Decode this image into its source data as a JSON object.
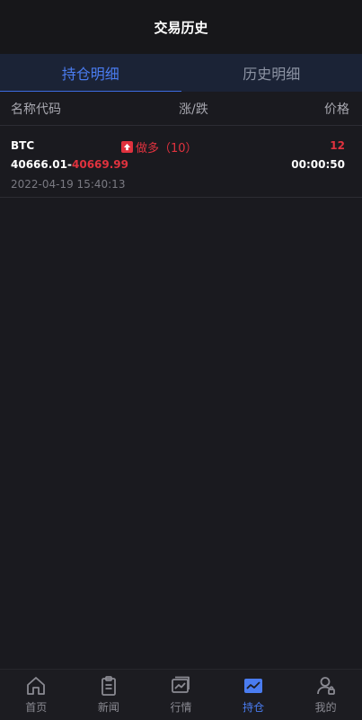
{
  "header": {
    "title": "交易历史"
  },
  "tabs": [
    {
      "label": "持仓明细",
      "active": true
    },
    {
      "label": "历史明细",
      "active": false
    }
  ],
  "columns": {
    "name": "名称代码",
    "change": "涨/跌",
    "price": "价格"
  },
  "positions": [
    {
      "symbol": "BTC",
      "open_price": "40666.01",
      "separator": "-",
      "current_price": "40669.99",
      "datetime": "2022-04-19 15:40:13",
      "direction": "做多（10）",
      "amount": "12",
      "countdown": "00:00:50"
    }
  ],
  "nav": [
    {
      "label": "首页",
      "icon": "home-icon",
      "active": false
    },
    {
      "label": "新闻",
      "icon": "news-icon",
      "active": false
    },
    {
      "label": "行情",
      "icon": "chart-icon",
      "active": false
    },
    {
      "label": "持仓",
      "icon": "position-icon",
      "active": true
    },
    {
      "label": "我的",
      "icon": "user-icon",
      "active": false
    }
  ],
  "colors": {
    "accent": "#4a7cf0",
    "up": "#e0323e",
    "background": "#1a1a1f"
  }
}
